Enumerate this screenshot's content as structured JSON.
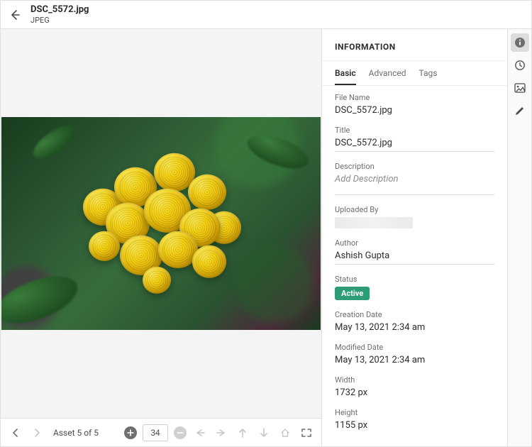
{
  "header": {
    "file_name": "DSC_5572.jpg",
    "file_type": "JPEG"
  },
  "info": {
    "panel_title": "INFORMATION",
    "tabs": {
      "basic": "Basic",
      "advanced": "Advanced",
      "tags": "Tags"
    },
    "fields": {
      "file_name_label": "File Name",
      "file_name_value": "DSC_5572.jpg",
      "title_label": "Title",
      "title_value": "DSC_5572.jpg",
      "description_label": "Description",
      "description_placeholder": "Add Description",
      "uploaded_by_label": "Uploaded By",
      "author_label": "Author",
      "author_value": "Ashish Gupta",
      "status_label": "Status",
      "status_value": "Active",
      "creation_label": "Creation Date",
      "creation_value": "May 13, 2021 2:34 am",
      "modified_label": "Modified Date",
      "modified_value": "May 13, 2021 2:34 am",
      "width_label": "Width",
      "width_value": "1732 px",
      "height_label": "Height",
      "height_value": "1155 px"
    }
  },
  "footer": {
    "counter": "Asset 5 of 5",
    "zoom_value": "34"
  }
}
